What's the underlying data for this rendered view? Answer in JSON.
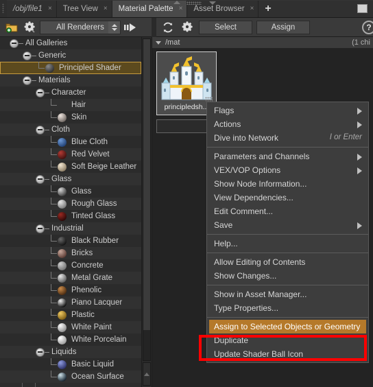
{
  "window": {
    "maximize_label": ""
  },
  "tabs": [
    {
      "label": "/obj/file1",
      "active": false,
      "italic": true,
      "close": "×"
    },
    {
      "label": "Tree View",
      "active": false,
      "italic": false,
      "close": "×"
    },
    {
      "label": "Material Palette",
      "active": true,
      "italic": false,
      "close": "×"
    },
    {
      "label": "Asset Browser",
      "active": false,
      "italic": false,
      "close": "×"
    }
  ],
  "tab_add_label": "+",
  "toolbar_left": {
    "new_folder_icon": "new-folder-icon",
    "gear_icon": "gear-icon",
    "renderer_value": "All Renderers",
    "forward_icon": "arrow-forward-icon"
  },
  "toolbar_right": {
    "refresh_icon": "refresh-icon",
    "gear_icon": "gear-icon",
    "select_label": "Select",
    "assign_label": "Assign",
    "help_label": "?"
  },
  "tree": {
    "items": [
      {
        "label": "All Galleries",
        "depth": 0,
        "type": "root"
      },
      {
        "label": "Generic",
        "depth": 1,
        "type": "group"
      },
      {
        "label": "Principled Shader",
        "depth": 2,
        "type": "leaf",
        "selected": true,
        "color": "#8a8a8a",
        "color2": "#2e2e2e"
      },
      {
        "label": "Materials",
        "depth": 1,
        "type": "group"
      },
      {
        "label": "Character",
        "depth": 2,
        "type": "group"
      },
      {
        "label": "Hair",
        "depth": 3,
        "type": "leaf-nosphere"
      },
      {
        "label": "Skin",
        "depth": 3,
        "type": "leaf",
        "color": "#efe6e0",
        "color2": "#6d6560"
      },
      {
        "label": "Cloth",
        "depth": 2,
        "type": "group"
      },
      {
        "label": "Blue Cloth",
        "depth": 3,
        "type": "leaf",
        "color": "#6f9ad6",
        "color2": "#1f3f73"
      },
      {
        "label": "Red Velvet",
        "depth": 3,
        "type": "leaf",
        "color": "#b33b35",
        "color2": "#3d100e"
      },
      {
        "label": "Soft Beige Leather",
        "depth": 3,
        "type": "leaf",
        "color": "#f3e7d2",
        "color2": "#8a7b63"
      },
      {
        "label": "Glass",
        "depth": 2,
        "type": "group"
      },
      {
        "label": "Glass",
        "depth": 3,
        "type": "leaf",
        "color": "#d7d7d7",
        "color2": "#3a3a3a"
      },
      {
        "label": "Rough Glass",
        "depth": 3,
        "type": "leaf",
        "color": "#e6e6e6",
        "color2": "#777777"
      },
      {
        "label": "Tinted Glass",
        "depth": 3,
        "type": "leaf",
        "color": "#9b2a22",
        "color2": "#2a0707"
      },
      {
        "label": "Industrial",
        "depth": 2,
        "type": "group"
      },
      {
        "label": "Black Rubber",
        "depth": 3,
        "type": "leaf",
        "color": "#6a6a6a",
        "color2": "#121212"
      },
      {
        "label": "Bricks",
        "depth": 3,
        "type": "leaf",
        "color": "#c8a89c",
        "color2": "#5a3a33"
      },
      {
        "label": "Concrete",
        "depth": 3,
        "type": "leaf",
        "color": "#cfcfcf",
        "color2": "#707070"
      },
      {
        "label": "Metal Grate",
        "depth": 3,
        "type": "leaf",
        "color": "#e8e8e8",
        "color2": "#5c5c5c"
      },
      {
        "label": "Phenolic",
        "depth": 3,
        "type": "leaf",
        "color": "#c98b4a",
        "color2": "#4a2a10"
      },
      {
        "label": "Piano Lacquer",
        "depth": 3,
        "type": "leaf",
        "color": "#f2f2f2",
        "color2": "#080808"
      },
      {
        "label": "Plastic",
        "depth": 3,
        "type": "leaf",
        "color": "#f0ca63",
        "color2": "#7a5a12"
      },
      {
        "label": "White Paint",
        "depth": 3,
        "type": "leaf",
        "color": "#fbfbfb",
        "color2": "#8d8d8d"
      },
      {
        "label": "White Porcelain",
        "depth": 3,
        "type": "leaf",
        "color": "#ffffff",
        "color2": "#9a9a9a"
      },
      {
        "label": "Liquids",
        "depth": 2,
        "type": "group"
      },
      {
        "label": "Basic Liquid",
        "depth": 3,
        "type": "leaf",
        "color": "#8f9ce0",
        "color2": "#2b2f66"
      },
      {
        "label": "Ocean Surface",
        "depth": 3,
        "type": "leaf",
        "color": "#cfe3ea",
        "color2": "#12202c"
      }
    ]
  },
  "network": {
    "path": "/mat",
    "child_count": "(1 chi",
    "node_label": "principledsh...",
    "node_icon": "castle-icon"
  },
  "context_menu": {
    "items": [
      {
        "label": "Flags",
        "submenu": true
      },
      {
        "label": "Actions",
        "submenu": true
      },
      {
        "label": "Dive into Network",
        "accel": "I or Enter"
      },
      {
        "separator": true
      },
      {
        "label": "Parameters and Channels",
        "submenu": true
      },
      {
        "label": "VEX/VOP Options",
        "submenu": true
      },
      {
        "label": "Show Node Information..."
      },
      {
        "label": "View Dependencies..."
      },
      {
        "label": "Edit Comment..."
      },
      {
        "label": "Save",
        "submenu": true
      },
      {
        "separator": true
      },
      {
        "label": "Help..."
      },
      {
        "separator": true
      },
      {
        "label": "Allow Editing of Contents"
      },
      {
        "label": "Show Changes..."
      },
      {
        "separator": true
      },
      {
        "label": "Show in Asset Manager..."
      },
      {
        "label": "Type Properties..."
      },
      {
        "separator": true
      },
      {
        "label": "Assign to Selected Objects or Geometry",
        "highlighted": true
      },
      {
        "label": "Duplicate"
      },
      {
        "label": "Update Shader Ball Icon"
      }
    ]
  },
  "annotation": {
    "highlight_color": "#ff0000",
    "target_label": "Assign to Selected Objects or Geometry"
  }
}
